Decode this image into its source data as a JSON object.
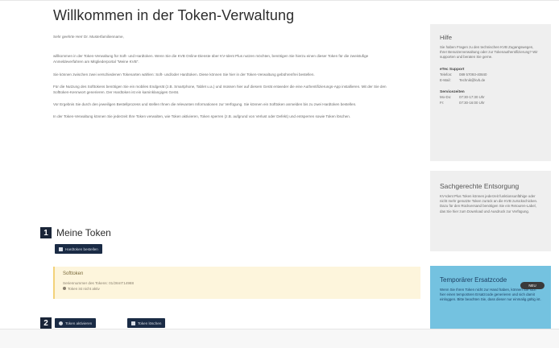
{
  "page": {
    "title": "Willkommen in der Token-Verwaltung",
    "greeting": "Sehr geehrte Herr Dr. Musterfamilienname,",
    "paragraphs": [
      "willkommen in der Token-Verwaltung für Soft- und Hardtoken. Wenn Sie die KVB Online-Dienste über KV-Ident Plus nutzen möchten, benötigen Sie hierzu einen dieser Token für die zweistufige Anmeldeverfahren am Mitgliederportal \"Meine KVB\".",
      "Sie können zwischen zwei verschiedenen Tokenarten wählen: Soft- und/oder Hardtoken. Diese können Sie hier in der Token-Verwaltung gebührenfrei bestellen.",
      "Für die Nutzung des Softtokens benötigen Sie ein mobiles Endgerät (z.B. Smartphone, Tablet u.a.) und müssen hier auf diesem Gerät entweder die eine Authentifizierungs-App installieren. Mit der Sie den Softtoken-Kennwort generieren. Der Hardtoken ist ein kaminklangiges Gerät.",
      "Vor Ergebnis Sie durch den jeweiligen Bestellprozess und stellen Ihnen die relevanten Informationen zur Verfügung. Sie können ein Softtoken anmelden bis zu zwei Hardtoken bestellen.",
      "In der Token-Verwaltung können Sie jederzeit Ihre Token verwalten, wie Token aktivieren, Token sperren (z.B. aufgrund von Verlust oder Defekt) und entsperren sowie Token löschen."
    ]
  },
  "token_section": {
    "number": "1",
    "title": "Meine Token",
    "order_button": "Hardtoken bestellen",
    "softtoken": {
      "title": "Softtoken",
      "serial": "Seriennummer des Tokens: 01/26mT14988",
      "status": "Token ist nicht aktiv"
    },
    "actions_number": "2",
    "activate_button": "Token aktivieren",
    "delete_button": "Token löschen"
  },
  "sidebar": {
    "help": {
      "title": "Hilfe",
      "text": "Sie haben Fragen zu den technischen KVB Zugangswegen, Ihrer Benutzerverwaltung oder zur Tokenauthentifizierung? Wir supporten und beraten Sie gerne.",
      "support_heading": "eTec Support",
      "phone_label": "Telefon:",
      "phone": "089 57093-40840",
      "email_label": "E-Mail:",
      "email": "Technik@kvb.de",
      "hours_heading": "Servicezeiten",
      "hours": [
        {
          "day": "Mo-Do:",
          "time": "07:30-17:30 Uhr"
        },
        {
          "day": "Fr:",
          "time": "07:30-16:00 Uhr"
        }
      ]
    },
    "sach": {
      "title": "Sachgerechte Entsorgung",
      "text": "KV-Ident Plus Token können jederzeit funktionsunfähige oder nicht mehr genutzte Token zurück an die KVB zurückschicken. Dazu für den Rückversand benötigen Sie ein Retouren-Label, das Sie hier zum Download und Ausdruck zur Verfügung."
    },
    "temp": {
      "title": "Temporärer Ersatzcode",
      "badge": "NEU",
      "text": "Wenn Sie Ihren Token nicht zur Hand haben, können Sie sich hier einen temporären Ersatzcode generieren und sich damit einloggen. Bitte beachten Sie, dass dieser nur einmalig gültig ist."
    }
  }
}
